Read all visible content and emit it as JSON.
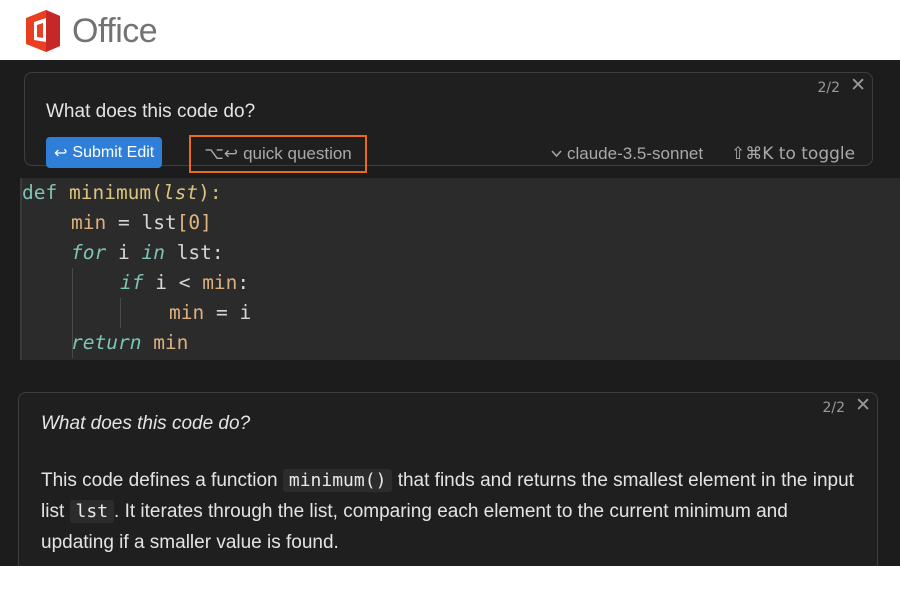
{
  "brand": {
    "name": "Office",
    "colors": {
      "orange": "#ea3e23",
      "red": "#b71c1c"
    }
  },
  "prompt": {
    "title": "What does this code do?",
    "counter": "2/2",
    "submit_label": "Submit Edit",
    "quick_label": "quick question",
    "quick_shortcut": "⌥↩",
    "model": "claude-3.5-sonnet",
    "toggle_hint": "⇧⌘K to toggle"
  },
  "code": {
    "l1_kw": "def",
    "l1_fn": "minimum",
    "l1_open": "(",
    "l1_param": "lst",
    "l1_close": "):",
    "l2_var": "min",
    "l2_eq": " = lst",
    "l2_index": "[0]",
    "l3_for": "for",
    "l3_mid": " i ",
    "l3_in": "in",
    "l3_rest": " lst:",
    "l4_if": "if",
    "l4_mid": " i < ",
    "l4_var": "min",
    "l4_colon": ":",
    "l5_var": "min",
    "l5_rest": " = i",
    "l6_ret": "return",
    "l6_var": " min"
  },
  "answer": {
    "question": "What does this code do?",
    "counter": "2/2",
    "p1": "This code defines a function",
    "code1": "minimum()",
    "p2": "that finds and returns the smallest element in the input list",
    "code2": "lst",
    "p3": ". It iterates through the list, comparing each element to the current minimum and updating if a smaller value is found."
  },
  "colors": {
    "accent": "#2f7fd9",
    "highlight": "#ec6b1b",
    "editor_bg": "#1c1c1c"
  }
}
